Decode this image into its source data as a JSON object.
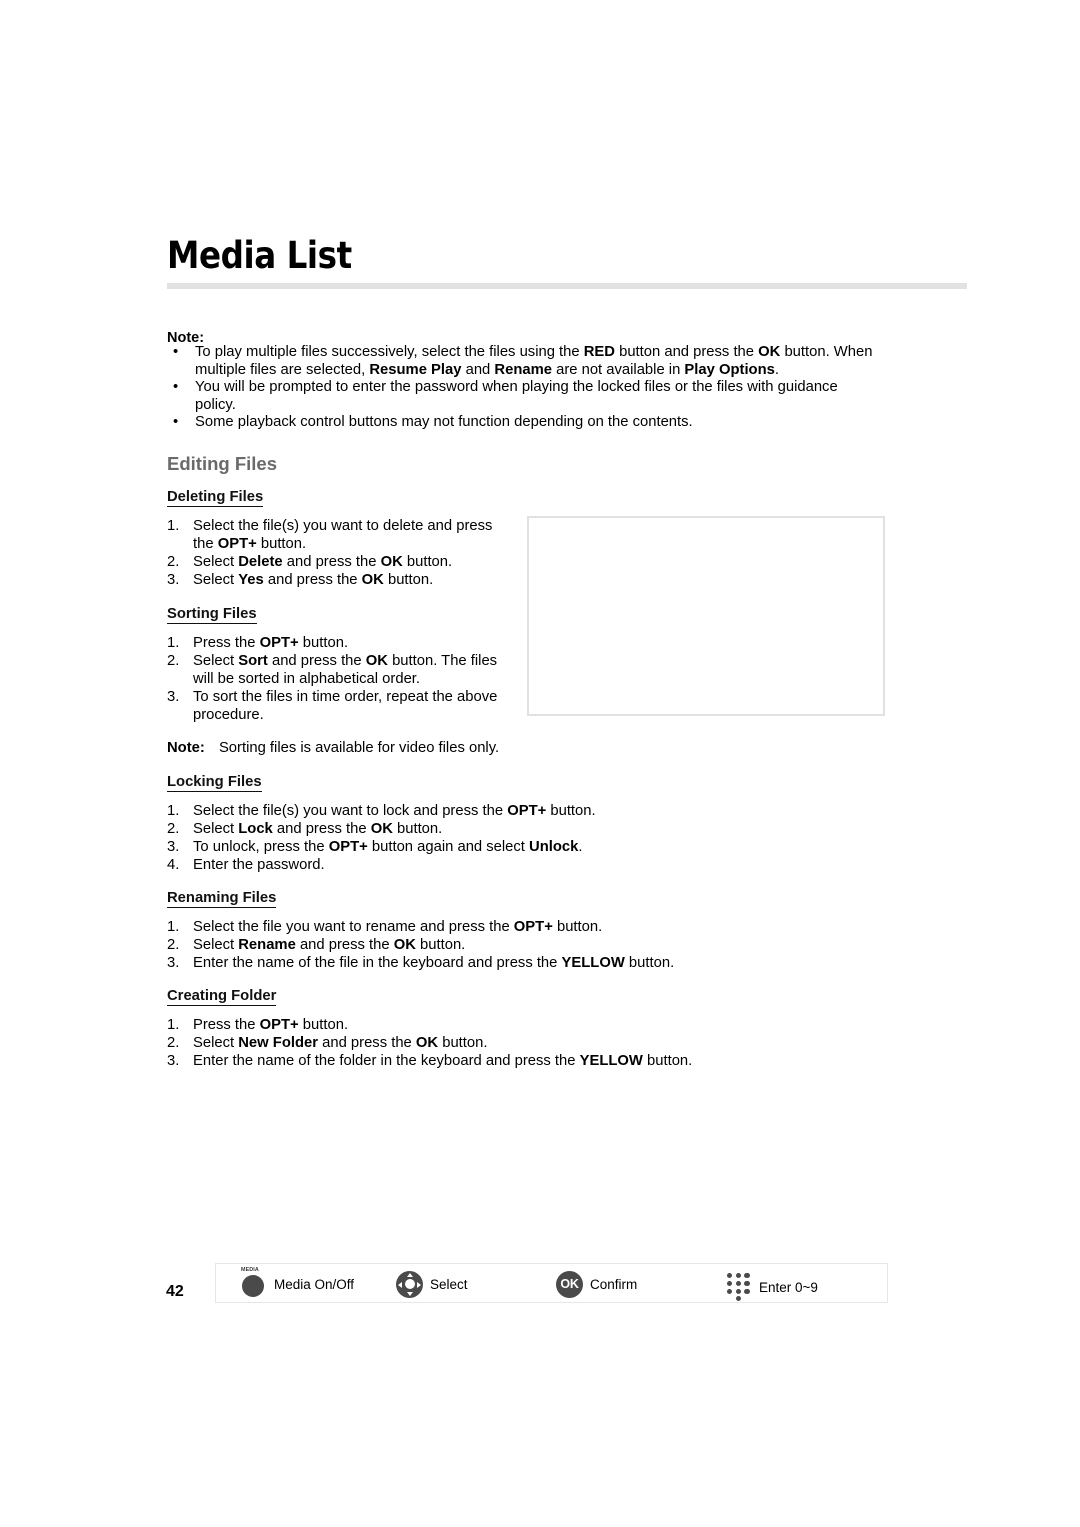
{
  "document": {
    "title": "Media List",
    "page_number": "42"
  },
  "note_block": {
    "label": "Note:",
    "bullet_mark": "•",
    "items": [
      "To play multiple files successively, select the files using the <b>RED</b> button and press the <b>OK</b> button. When multiple files are selected, <b>Resume Play</b> and <b>Rename</b> are not available in <b>Play Options</b>.",
      "You will be prompted to enter the password when playing the locked files or the files with guidance policy.",
      "Some playback control buttons may not function depending on the contents."
    ]
  },
  "section": {
    "heading": "Editing Files"
  },
  "subsections": [
    {
      "heading": "Deleting Files",
      "steps": [
        "Select the file(s) you want to delete and press the <b>OPT+</b> button.",
        "Select <b>Delete</b> and press the <b>OK</b> button.",
        "Select <b>Yes</b> and press the <b>OK</b> button."
      ]
    },
    {
      "heading": "Sorting Files",
      "steps": [
        "Press the <b>OPT+</b> button.",
        "Select <b>Sort</b> and press the <b>OK</b> button. The files will be sorted in alphabetical order.",
        "To sort the files in time order, repeat the above procedure."
      ],
      "note": {
        "label": "Note:",
        "text": "Sorting files is available for video files only."
      }
    },
    {
      "heading": "Locking Files",
      "steps": [
        "Select the file(s) you want to lock and press the <b>OPT+</b> button.",
        "Select <b>Lock</b> and press the <b>OK</b> button.",
        "To unlock, press the <b>OPT+</b> button again and select <b>Unlock</b>.",
        "Enter the password."
      ]
    },
    {
      "heading": "Renaming Files",
      "steps": [
        "Select the file you want to rename and press the <b>OPT+</b> button.",
        "Select <b>Rename</b> and press the <b>OK</b> button.",
        "Enter the name of the file in the keyboard and press the <b>YELLOW</b> button."
      ]
    },
    {
      "heading": "Creating Folder",
      "steps": [
        "Press the <b>OPT+</b> button.",
        "Select <b>New Folder</b> and press the <b>OK</b> button.",
        "Enter the name of the folder in the keyboard and press the <b>YELLOW</b> button."
      ]
    }
  ],
  "legend": {
    "items": [
      {
        "icon": "media-button-icon",
        "icon_text": "MEDIA",
        "label": "Media On/Off"
      },
      {
        "icon": "direction-pad-icon",
        "icon_text": "",
        "label": "Select"
      },
      {
        "icon": "ok-button-icon",
        "icon_text": "OK",
        "label": "Confirm"
      },
      {
        "icon": "numeric-keypad-icon",
        "icon_text": "",
        "label": "Enter 0~9"
      }
    ]
  },
  "colors": {
    "rule": "#e2e2e2",
    "section_heading": "#6a6a6a",
    "icon_fill": "#4a4a4a",
    "box_border": "#e1e1e1"
  }
}
